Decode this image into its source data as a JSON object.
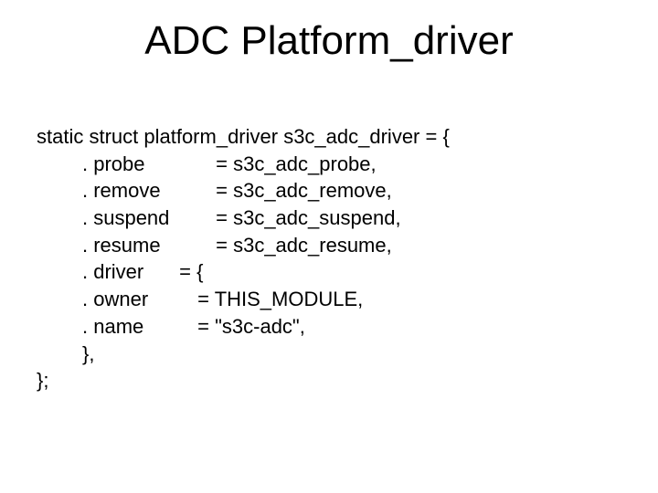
{
  "title": "ADC Platform_driver",
  "code": {
    "line0": "static struct platform_driver s3c_adc_driver = {",
    "probe": {
      "field": ". probe",
      "value": "= s3c_adc_probe,"
    },
    "remove": {
      "field": ". remove",
      "value": "= s3c_adc_remove,"
    },
    "suspend": {
      "field": ". suspend",
      "value": "= s3c_adc_suspend,"
    },
    "resume": {
      "field": ". resume",
      "value": "= s3c_adc_resume,"
    },
    "driver": {
      "field": ". driver",
      "value": "= {"
    },
    "owner": {
      "field": ". owner",
      "value": "= THIS_MODULE,"
    },
    "name": {
      "field": ". name",
      "value": "= \"s3c-adc\","
    },
    "close_inner": "},",
    "close_outer": "};"
  }
}
